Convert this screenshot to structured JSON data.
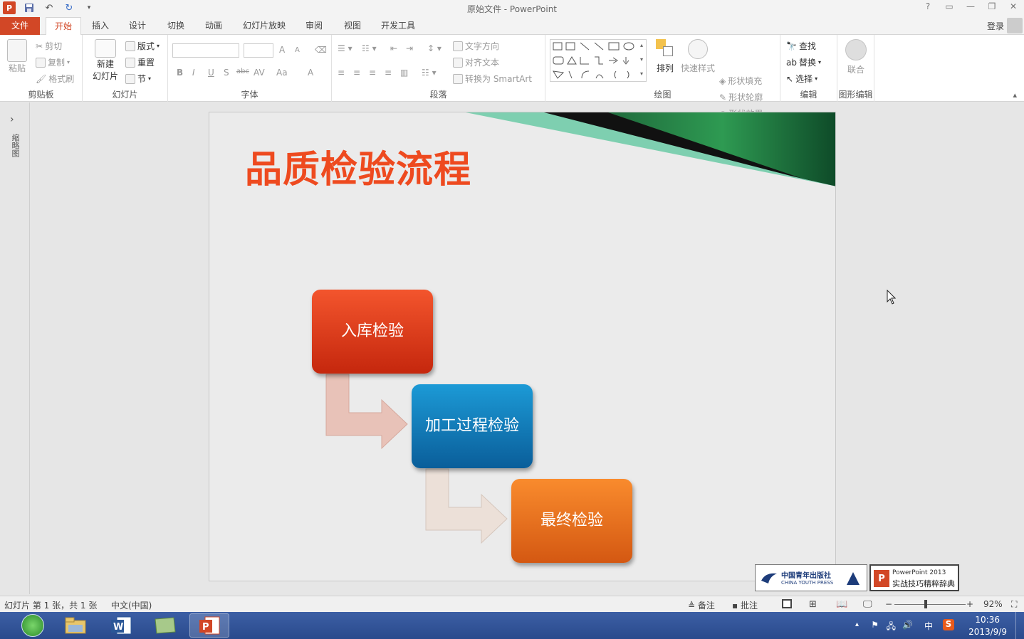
{
  "app": {
    "window_title": "原始文件 - PowerPoint",
    "logo_letter": "P",
    "help": "?",
    "login": "登录"
  },
  "tabs": [
    "文件",
    "开始",
    "插入",
    "设计",
    "切换",
    "动画",
    "幻灯片放映",
    "审阅",
    "视图",
    "开发工具"
  ],
  "ribbon": {
    "clipboard": {
      "paste": "粘贴",
      "cut": "剪切",
      "copy": "复制",
      "format_painter": "格式刷",
      "label": "剪贴板"
    },
    "slides": {
      "new_slide_l1": "新建",
      "new_slide_l2": "幻灯片",
      "layout": "版式",
      "reset": "重置",
      "section": "节",
      "label": "幻灯片"
    },
    "font": {
      "label": "字体",
      "bold": "B",
      "italic": "I",
      "underline": "U",
      "shadow": "S",
      "strike": "abc",
      "spacing": "AV",
      "case": "Aa",
      "color": "A",
      "grow": "A",
      "shrink": "A"
    },
    "paragraph": {
      "label": "段落",
      "text_direction": "文字方向",
      "align_text": "对齐文本",
      "smartart": "转换为 SmartArt"
    },
    "drawing": {
      "label": "绘图",
      "arrange": "排列",
      "quick_styles": "快速样式",
      "shape_fill": "形状填充",
      "shape_outline": "形状轮廓",
      "shape_effects": "形状效果"
    },
    "editing": {
      "label": "编辑",
      "find": "查找",
      "replace": "替换",
      "select": "选择"
    },
    "shape_edit": {
      "label": "图形编辑",
      "combine": "联合"
    }
  },
  "leftpane": {
    "label": "缩略图"
  },
  "slide": {
    "title": "品质检验流程",
    "steps": [
      "入库检验",
      "加工过程检验",
      "最终检验"
    ],
    "colors": {
      "title": "#ee4a1f",
      "step1": "#e03e1c",
      "step2": "#1383c4",
      "step3": "#ec7420"
    }
  },
  "publishers": {
    "cyp_cn": "中国青年出版社",
    "cyp_en": "CHINA YOUTH PRESS",
    "book_line1": "PowerPoint 2013",
    "book_line2": "实战技巧精粹辞典"
  },
  "statusbar": {
    "slide_info": "幻灯片 第 1 张，共 1 张",
    "language": "中文(中国)",
    "notes": "备注",
    "comments": "批注",
    "zoom": "92%"
  },
  "taskbar": {
    "ime": "中",
    "time": "10:36",
    "date": "2013/9/9"
  }
}
